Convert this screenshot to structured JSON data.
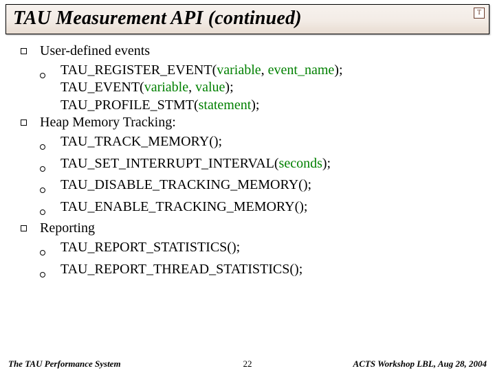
{
  "title": "TAU Measurement API (continued)",
  "logo_char": "T",
  "sections": [
    {
      "heading": "User-defined events",
      "items": [
        {
          "lines": [
            {
              "segments": [
                {
                  "t": "TAU_REGISTER_EVENT("
                },
                {
                  "t": "variable",
                  "p": true
                },
                {
                  "t": ", "
                },
                {
                  "t": "event_name",
                  "p": true
                },
                {
                  "t": ");"
                }
              ]
            },
            {
              "segments": [
                {
                  "t": "TAU_EVENT("
                },
                {
                  "t": "variable",
                  "p": true
                },
                {
                  "t": ", "
                },
                {
                  "t": "value",
                  "p": true
                },
                {
                  "t": ");"
                }
              ]
            },
            {
              "segments": [
                {
                  "t": "TAU_PROFILE_STMT("
                },
                {
                  "t": "statement",
                  "p": true
                },
                {
                  "t": ");"
                }
              ]
            }
          ]
        }
      ]
    },
    {
      "heading": "Heap Memory Tracking:",
      "items": [
        {
          "lines": [
            {
              "segments": [
                {
                  "t": "TAU_TRACK_MEMORY();"
                }
              ]
            }
          ]
        },
        {
          "lines": [
            {
              "segments": [
                {
                  "t": "TAU_SET_INTERRUPT_INTERVAL("
                },
                {
                  "t": "seconds",
                  "p": true
                },
                {
                  "t": ");"
                }
              ]
            }
          ]
        },
        {
          "lines": [
            {
              "segments": [
                {
                  "t": "TAU_DISABLE_TRACKING_MEMORY();"
                }
              ]
            }
          ]
        },
        {
          "lines": [
            {
              "segments": [
                {
                  "t": "TAU_ENABLE_TRACKING_MEMORY();"
                }
              ]
            }
          ]
        }
      ]
    },
    {
      "heading": "Reporting",
      "items": [
        {
          "lines": [
            {
              "segments": [
                {
                  "t": "TAU_REPORT_STATISTICS();"
                }
              ]
            }
          ]
        },
        {
          "lines": [
            {
              "segments": [
                {
                  "t": "TAU_REPORT_THREAD_STATISTICS();"
                }
              ]
            }
          ]
        }
      ]
    }
  ],
  "footer": {
    "left": "The TAU Performance System",
    "center": "22",
    "right": "ACTS Workshop LBL, Aug 28, 2004"
  }
}
